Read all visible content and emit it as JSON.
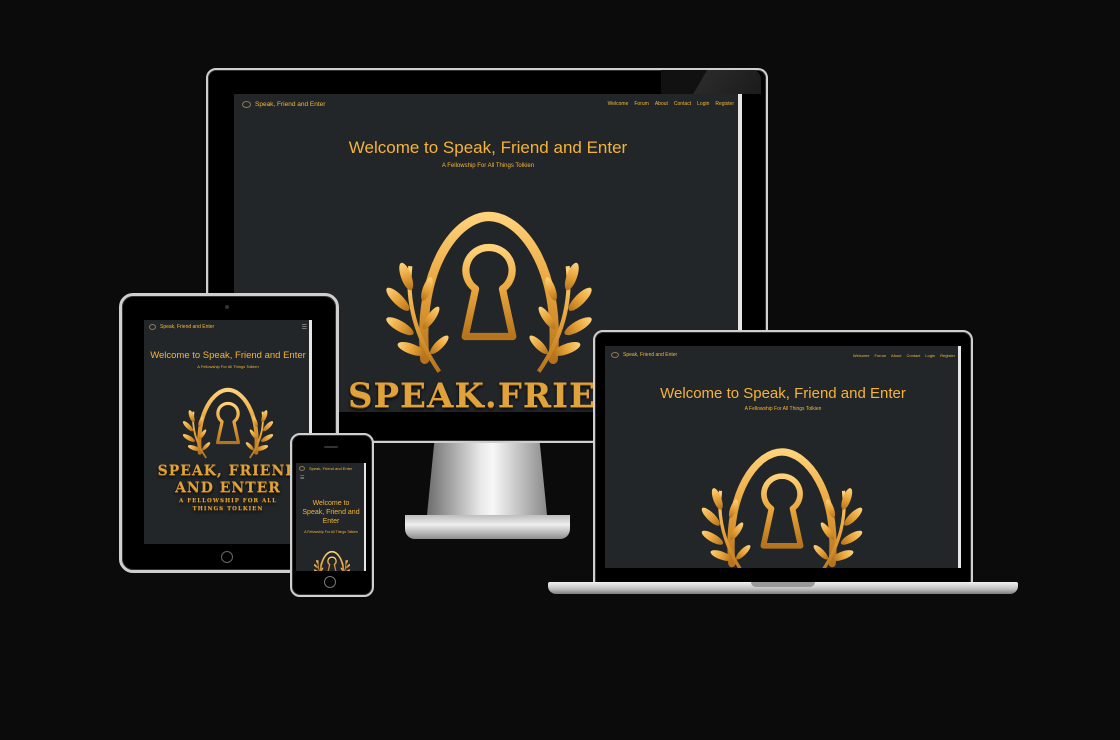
{
  "site": {
    "brand": "Speak, Friend and Enter",
    "nav": [
      "Welcome",
      "Forum",
      "About",
      "Contact",
      "Login",
      "Register"
    ],
    "menu_icon": "hamburger-icon",
    "hero_title": "Welcome to Speak, Friend and Enter",
    "hero_title_phone": [
      "Welcome to",
      "Speak, Friend and",
      "Enter"
    ],
    "hero_subtitle": "A Fellowship For All Things Tolkien",
    "logo_text_desktop": "SPEAK.FRIEN",
    "logo_text_tablet": [
      "SPEAK, FRIEND",
      "AND ENTER"
    ],
    "logo_tagline_tablet": [
      "A FELLOWSHIP FOR ALL",
      "THINGS TOLKIEN"
    ],
    "logo_icon": "keyhole-laurel-icon"
  },
  "colors": {
    "background": "#0b0b0c",
    "screen": "#222629",
    "accent": "#f5b437",
    "gold": "#e0a23a"
  }
}
